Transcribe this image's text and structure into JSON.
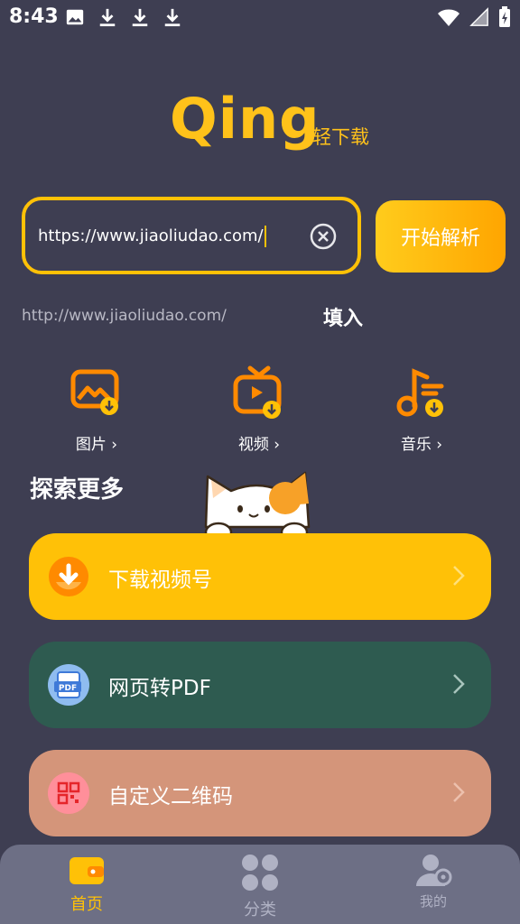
{
  "status_bar": {
    "time": "8:43",
    "icons_left": [
      "image-icon",
      "download-icon",
      "download-icon",
      "download-icon"
    ],
    "icons_right": [
      "wifi-icon",
      "signal-icon",
      "battery-charging-icon"
    ]
  },
  "logo": {
    "word": "Qing",
    "subtitle": "轻下载"
  },
  "search": {
    "value": "https://www.jiaoliudao.com/",
    "parse_label": "开始解析"
  },
  "clipboard": {
    "url": "http://www.jiaoliudao.com/",
    "fill_label": "填入"
  },
  "categories": [
    {
      "label": "图片",
      "icon": "image-download-icon"
    },
    {
      "label": "视频",
      "icon": "video-download-icon"
    },
    {
      "label": "音乐",
      "icon": "music-download-icon"
    }
  ],
  "explore": {
    "title": "探索更多",
    "cards": [
      {
        "label": "下载视频号",
        "icon": "download-circle-icon"
      },
      {
        "label": "网页转PDF",
        "icon": "pdf-icon"
      },
      {
        "label": "自定义二维码",
        "icon": "qr-code-icon"
      }
    ]
  },
  "bottom_nav": [
    {
      "label": "首页",
      "icon": "wallet-icon",
      "active": true
    },
    {
      "label": "分类",
      "icon": "grid-icon",
      "active": false
    },
    {
      "label": "我的",
      "icon": "user-icon",
      "active": false
    }
  ],
  "colors": {
    "background": "#3e3e52",
    "accent": "#ffc107",
    "card_download": "#ffc107",
    "card_pdf": "#2e5b50",
    "card_qr": "#d4957a",
    "nav_bg": "#6d6f85"
  }
}
